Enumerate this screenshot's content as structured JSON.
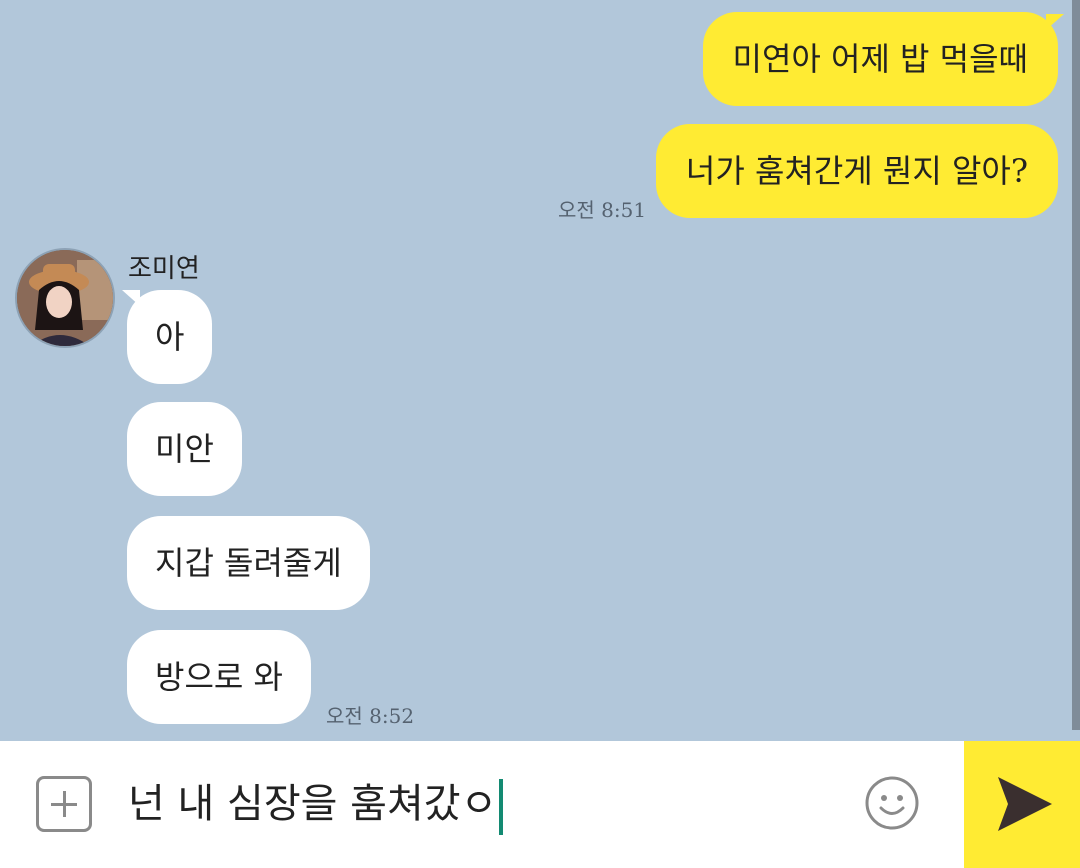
{
  "messages": {
    "mine": [
      {
        "text": "미연아 어제 밥 먹을때"
      },
      {
        "text": "너가 훔쳐간게 뭔지 알아?"
      }
    ],
    "mine_time": "오전 8:51",
    "sender": "조미연",
    "theirs": [
      {
        "text": "아"
      },
      {
        "text": "미안"
      },
      {
        "text": "지갑 돌려줄게"
      },
      {
        "text": "방으로 와"
      }
    ],
    "theirs_time": "오전 8:52"
  },
  "input": {
    "value": "넌 내 심장을 훔쳐갔ㅇ"
  },
  "icons": {
    "attach": "plus-square-icon",
    "emoji": "smiley-icon",
    "send": "send-arrow-icon"
  },
  "colors": {
    "background": "#b2c7da",
    "my_bubble": "#ffeb33",
    "their_bubble": "#ffffff",
    "caret": "#138a72",
    "send_button": "#ffeb33"
  }
}
